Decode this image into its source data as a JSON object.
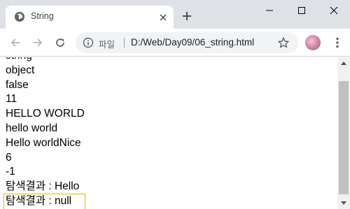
{
  "browser": {
    "tab": {
      "title": "String",
      "favicon": "globe-icon"
    },
    "toolbar": {
      "scheme_label": "파일",
      "url": "D:/Web/Day09/06_string.html"
    },
    "colors": {
      "tabstrip": "#dee1e6",
      "omnibox": "#f1f3f4",
      "focus_outline": "#e3b600"
    }
  },
  "output": {
    "lines": [
      "string",
      "object",
      "false",
      "11",
      "HELLO WORLD",
      "hello world",
      "Hello worldNice",
      "6",
      "-1",
      "탐색결과 : Hello",
      "탐색결과 : null"
    ]
  }
}
